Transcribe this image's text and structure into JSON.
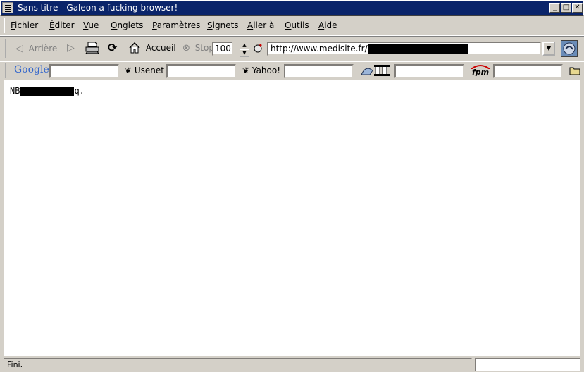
{
  "window": {
    "title": "Sans titre - Galeon a fucking browser!"
  },
  "menu": [
    "Fichier",
    "Éditer",
    "Vue",
    "Onglets",
    "Paramètres",
    "Signets",
    "Aller à",
    "Outils",
    "Aide"
  ],
  "menu_mnemonics": [
    "F",
    "É",
    "V",
    "O",
    "P",
    "S",
    "A",
    "O",
    "A"
  ],
  "toolbar": {
    "back_label": "Arrière",
    "home_label": "Accueil",
    "stop_label": "Stop",
    "zoom_value": "100",
    "url_value": "http://www.medisite.fr/"
  },
  "searchbar": {
    "google_label": "Google",
    "usenet_label": "Usenet",
    "yahoo_label": "Yahoo!",
    "fpm_label": "fpm"
  },
  "content": {
    "text_prefix": "NB",
    "text_suffix": "q."
  },
  "status": {
    "text": "Fini."
  },
  "colors": {
    "titlebar": "#0a246a",
    "chrome": "#d4d0c8",
    "google_blue": "#3366cc",
    "google_red": "#cc3333",
    "fpm_red": "#cc0000"
  }
}
